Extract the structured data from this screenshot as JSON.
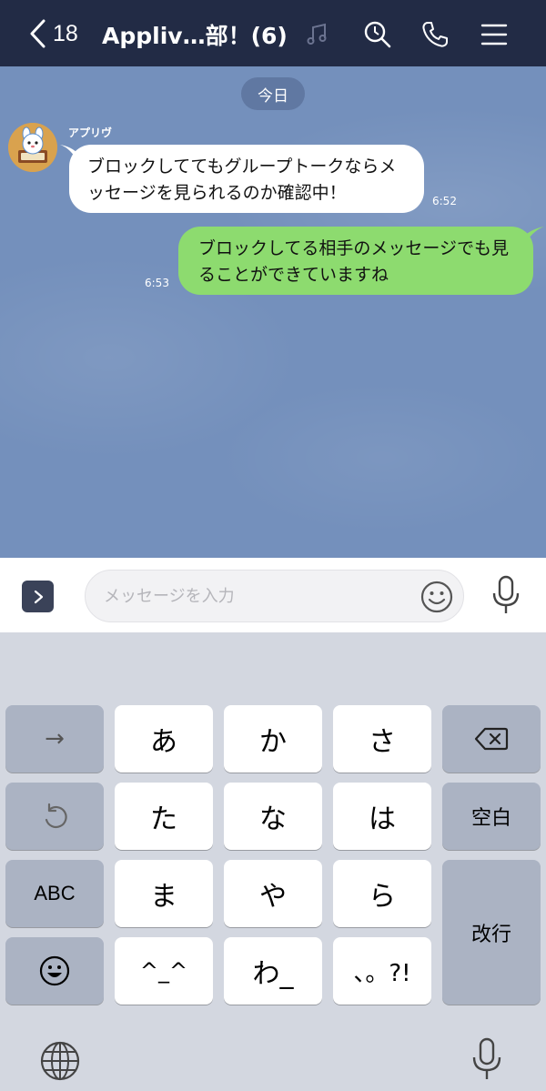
{
  "header": {
    "back_count": "18",
    "title": "Appliv…部！(6)",
    "icons": [
      "music-icon",
      "search-icon",
      "phone-icon",
      "menu-icon"
    ]
  },
  "chat": {
    "date_label": "今日",
    "messages": [
      {
        "direction": "incoming",
        "sender": "アプリヴ",
        "text_line1": "ブロックしててもグループトークならメ",
        "text_line2": "ッセージを見られるのか確認中！",
        "time": "6:52"
      },
      {
        "direction": "outgoing",
        "text_line1": "ブロックしてる相手のメッセージでも見",
        "text_line2": "ることができていますね",
        "time": "6:53"
      }
    ]
  },
  "input": {
    "placeholder": "メッセージを入力"
  },
  "keyboard": {
    "keys": {
      "arrow": "→",
      "a": "あ",
      "ka": "か",
      "sa": "さ",
      "ta": "た",
      "na": "な",
      "ha": "は",
      "abc": "ABC",
      "ma": "ま",
      "ya": "や",
      "ra": "ら",
      "kaomoji": "^_^",
      "wa": "わ_",
      "punct": "、。?!",
      "space": "空白",
      "enter": "改行"
    }
  },
  "colors": {
    "header_bg": "#222b45",
    "chat_bg": "#7490bc",
    "outgoing_bubble": "#8ddb6f",
    "incoming_bubble": "#ffffff"
  }
}
